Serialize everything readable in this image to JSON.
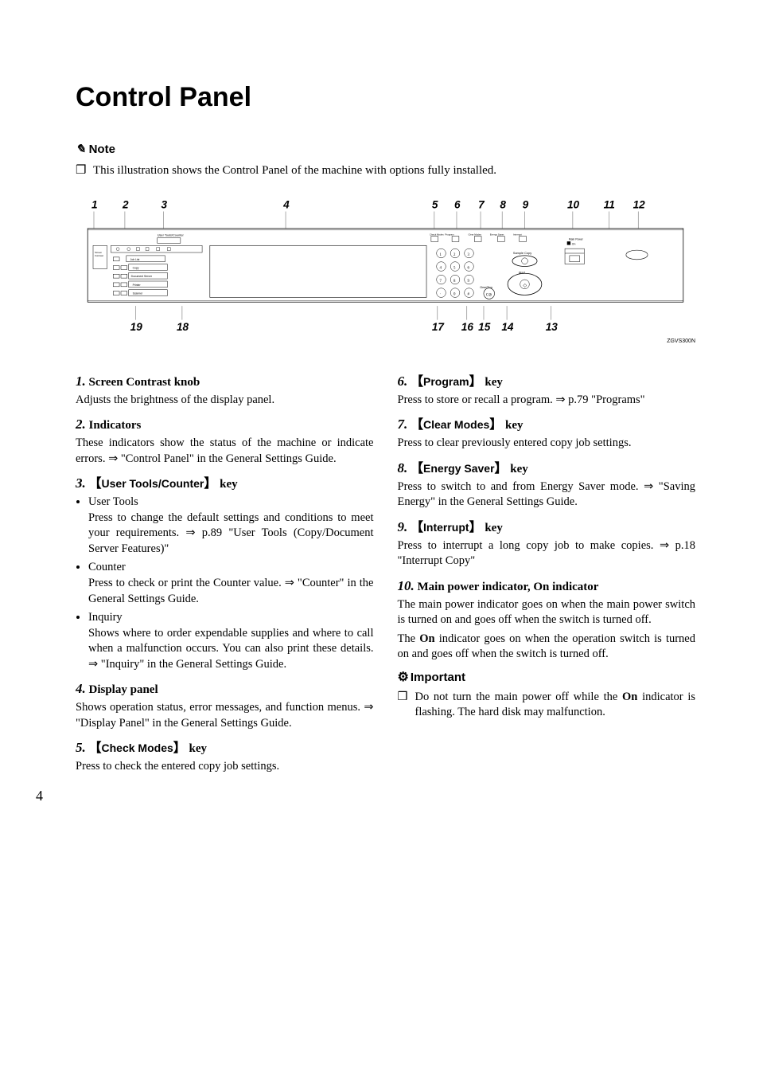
{
  "page": {
    "title": "Control Panel",
    "page_number": "4"
  },
  "note": {
    "label": "Note",
    "text": "This illustration shows the Control Panel of the machine with options fully installed."
  },
  "diagram": {
    "top_numbers": [
      "1",
      "2",
      "3",
      "4",
      "5",
      "6",
      "7",
      "8",
      "9",
      "10",
      "11",
      "12"
    ],
    "bot_numbers": [
      "19",
      "18",
      "17",
      "16",
      "15",
      "14",
      "13"
    ],
    "code": "ZGVS300N"
  },
  "left_items": [
    {
      "num": "1.",
      "title": "Screen Contrast knob",
      "body": [
        "Adjusts the brightness of the display panel."
      ]
    },
    {
      "num": "2.",
      "title": "Indicators",
      "body": [
        "These indicators show the status of the machine or indicate errors.  ⇒ \"Control Panel\" in the General Settings Guide."
      ]
    },
    {
      "num": "3.",
      "key": "User Tools/Counter",
      "sublist": [
        {
          "title": "User Tools",
          "body": "Press to change the default settings and conditions to meet your requirements. ⇒ p.89 \"User Tools (Copy/Document Server Features)\""
        },
        {
          "title": "Counter",
          "body": "Press to check or print the Counter value. ⇒ \"Counter\" in the General Settings Guide."
        },
        {
          "title": "Inquiry",
          "body": "Shows where to order expendable supplies and where to call when a malfunction occurs. You can also print these details. ⇒ \"Inquiry\" in the General Settings Guide."
        }
      ]
    },
    {
      "num": "4.",
      "title": "Display panel",
      "body": [
        "Shows operation status, error messages, and function menus.  ⇒ \"Display Panel\" in the General Settings Guide."
      ]
    },
    {
      "num": "5.",
      "key": "Check Modes",
      "body": [
        "Press to check the entered copy job settings."
      ]
    }
  ],
  "right_items": [
    {
      "num": "6.",
      "key": "Program",
      "body": [
        "Press to store or recall a program. ⇒ p.79 \"Programs\""
      ]
    },
    {
      "num": "7.",
      "key": "Clear Modes",
      "body": [
        "Press to clear previously entered copy job settings."
      ]
    },
    {
      "num": "8.",
      "key": "Energy Saver",
      "body": [
        "Press to switch to and from Energy Saver mode. ⇒ \"Saving Energy\" in the General Settings Guide."
      ]
    },
    {
      "num": "9.",
      "key": "Interrupt",
      "body": [
        "Press to interrupt a long copy job to make copies. ⇒ p.18 \"Interrupt Copy\""
      ]
    },
    {
      "num": "10.",
      "title": "Main power indicator, On indicator",
      "body": [
        "The main power indicator goes on when the main power switch is turned on and goes off when the switch is turned off.",
        "The <b>On</b> indicator goes on when the operation switch is turned on and goes off when the switch is turned off."
      ]
    }
  ],
  "important": {
    "label": "Important",
    "text": "Do not turn the main power off while the <b>On</b> indicator is flashing. The hard disk may malfunction."
  }
}
